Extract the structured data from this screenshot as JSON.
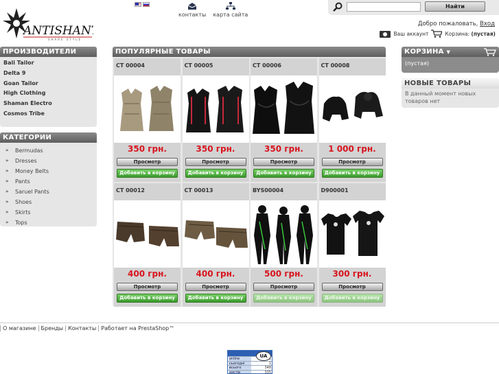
{
  "header": {
    "logo_text": "ANTISHANTI",
    "logo_subtext": "SHARE STYLE",
    "languages": [
      "en",
      "ru"
    ],
    "top_links": [
      {
        "label": "контакты",
        "icon": "mail-icon"
      },
      {
        "label": "карта сайта",
        "icon": "sitemap-icon"
      }
    ],
    "search": {
      "placeholder": "",
      "button": "Найти"
    },
    "welcome": "Добро пожаловать,",
    "login": "Вход",
    "account": "Ваш аккаунт",
    "cart_label": "Корзина:",
    "cart_value": "(пустая)"
  },
  "manufacturers": {
    "title": "ПРОИЗВОДИТЕЛИ",
    "items": [
      "Bali Tailor",
      "Delta 9",
      "Goan Tailor",
      "High Clothing",
      "Shaman Electro",
      "Cosmos Tribe"
    ]
  },
  "categories": {
    "title": "КАТЕГОРИИ",
    "items": [
      "Bermudas",
      "Dresses",
      "Money Belts",
      "Pants",
      "Saruel Pants",
      "Shoes",
      "Skirts",
      "Tops"
    ]
  },
  "popular": {
    "title": "ПОПУЛЯРНЫЕ ТОВАРЫ",
    "view_label": "Просмотр",
    "cart_label": "Добавить в корзину",
    "products": [
      {
        "code": "CT 00004",
        "price": "350 грн.",
        "image": "tank-tops-beige",
        "available": true
      },
      {
        "code": "CT 00005",
        "price": "350 грн.",
        "image": "tank-tops-black-red",
        "available": true
      },
      {
        "code": "CT 00006",
        "price": "350 грн.",
        "image": "tank-tops-black",
        "available": true
      },
      {
        "code": "CT 00008",
        "price": "1 000 грн.",
        "image": "hoodies-black",
        "available": true
      },
      {
        "code": "CT 00012",
        "price": "400 грн.",
        "image": "shorts-brown",
        "available": true
      },
      {
        "code": "CT 00013",
        "price": "400 грн.",
        "image": "shorts-khaki",
        "available": true
      },
      {
        "code": "BYS00004",
        "price": "500 грн.",
        "image": "jumpsuits-black-green",
        "available": false
      },
      {
        "code": "D900001",
        "price": "300 грн.",
        "image": "tshirts-black",
        "available": false
      }
    ]
  },
  "cart": {
    "title": "КОРЗИНА",
    "empty": "(пустая)"
  },
  "new_products": {
    "title": "НОВЫЕ ТОВАРЫ",
    "text": "В данный момент новых товаров нет"
  },
  "footer": {
    "links": [
      "О магазине",
      "Бренды",
      "Контакты",
      "Работает на PrestaShop™"
    ]
  },
  "counter": {
    "badge": "UA",
    "rows": [
      {
        "label": "online",
        "value": "1"
      },
      {
        "label": "сьогодні",
        "value": "1"
      },
      {
        "label": "всього",
        "value": "348"
      },
      {
        "label": "хостів",
        "value": "335"
      }
    ]
  },
  "colors": {
    "price": "#d8141e",
    "green": "#3a9a2c",
    "header_gray": "#6e6e6e"
  }
}
